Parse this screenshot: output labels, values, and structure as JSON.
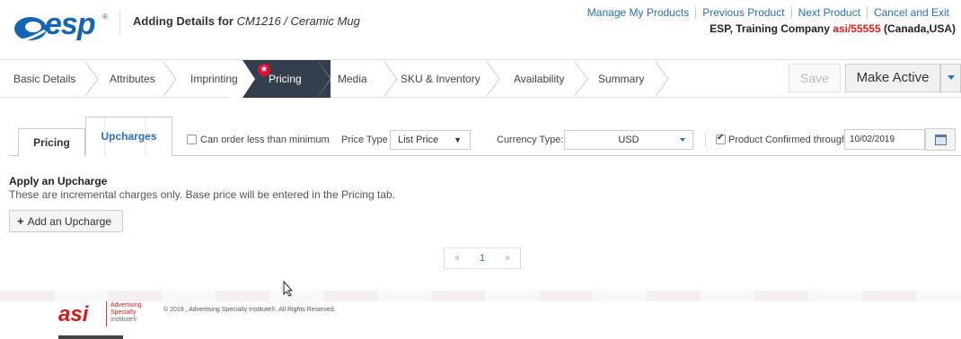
{
  "header": {
    "logo_text": "esp",
    "title_prefix": "Adding Details for ",
    "title_product": "CM1216 / Ceramic Mug",
    "links": [
      "Manage My Products",
      "Previous Product",
      "Next Product",
      "Cancel and Exit"
    ],
    "company_name": "ESP, Training Company ",
    "asi_number": "asi/55555",
    "company_region": " (Canada,USA)"
  },
  "steps": [
    {
      "label": "Basic Details"
    },
    {
      "label": "Attributes"
    },
    {
      "label": "Imprinting"
    },
    {
      "label": "Pricing",
      "active": true
    },
    {
      "label": "Media"
    },
    {
      "label": "SKU & Inventory"
    },
    {
      "label": "Availability"
    },
    {
      "label": "Summary"
    }
  ],
  "actions": {
    "save_label": "Save",
    "make_active_label": "Make Active"
  },
  "tabs": {
    "pricing": "Pricing",
    "upcharges": "Upcharges"
  },
  "options": {
    "can_order_less_label": "Can order less than minimum",
    "price_type_label": "Price Type",
    "price_type_value": "List Price",
    "currency_type_label": "Currency Type:",
    "currency_value": "USD",
    "confirmed_label": "Product Confirmed through",
    "confirmed_date": "10/02/2019"
  },
  "upcharge": {
    "heading": "Apply an Upcharge",
    "description": "These are incremental charges only. Base price will be entered in the Pricing tab.",
    "add_button": "Add an Upcharge"
  },
  "pager": {
    "prev": "«",
    "page": "1",
    "next": "»"
  },
  "footer": {
    "asi_line1": "Advertising",
    "asi_line2": "Specialty",
    "asi_line3": "Institute®",
    "copyright": "© 2019 , Advertising Specialty Institute®. All Rights Reserved."
  },
  "colors": {
    "brand_blue": "#1565b3",
    "link_blue": "#2a6fb8",
    "active_step_bg": "#333f4d",
    "asi_red": "#e02020"
  }
}
